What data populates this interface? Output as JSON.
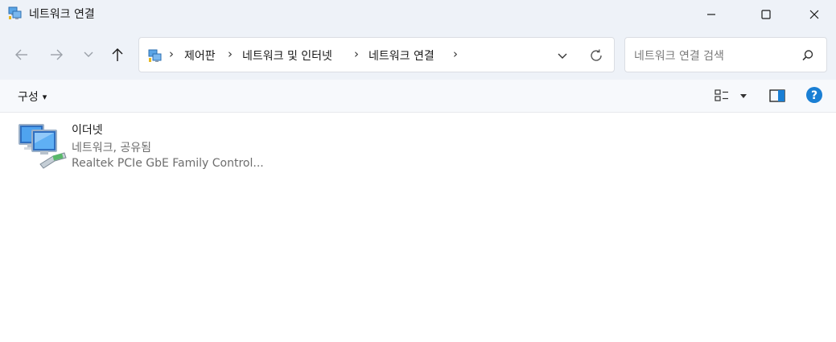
{
  "window": {
    "title": "네트워크 연결",
    "icon": "network-connections-icon"
  },
  "titlebar_controls": {
    "minimize": "minimize-icon",
    "maximize": "maximize-icon",
    "close": "close-icon"
  },
  "navigation": {
    "back": "arrow-left-icon",
    "forward": "arrow-right-icon",
    "recent": "chevron-down-icon",
    "up": "arrow-up-icon"
  },
  "address_bar": {
    "breadcrumbs": [
      "제어판",
      "네트워크 및 인터넷",
      "네트워크 연결"
    ],
    "separator": "›"
  },
  "search": {
    "placeholder": "네트워크 연결 검색"
  },
  "command_bar": {
    "organize_label": "구성",
    "organize_arrow": "▾"
  },
  "connections": [
    {
      "name": "이더넷",
      "status": "네트워크, 공유됨",
      "device": "Realtek PCIe GbE Family Control..."
    }
  ],
  "colors": {
    "titlebar_bg": "#eef2f8",
    "help_blue": "#1a7fd4",
    "secondary_text": "#6d6d6d"
  }
}
